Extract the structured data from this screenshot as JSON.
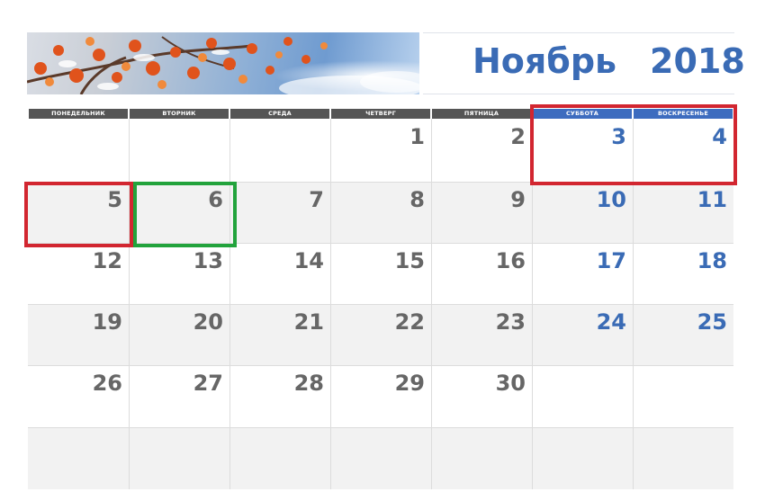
{
  "calendar": {
    "month": "Ноябрь",
    "year": "2018",
    "weekdays": [
      "ПОНЕДЕЛЬНИК",
      "ВТОРНИК",
      "СРЕДА",
      "ЧЕТВЕРГ",
      "ПЯТНИЦА",
      "СУББОТА",
      "ВОСКРЕСЕНЬЕ"
    ],
    "weeks": [
      [
        "",
        "",
        "",
        "1",
        "2",
        "3",
        "4"
      ],
      [
        "5",
        "6",
        "7",
        "8",
        "9",
        "10",
        "11"
      ],
      [
        "12",
        "13",
        "14",
        "15",
        "16",
        "17",
        "18"
      ],
      [
        "19",
        "20",
        "21",
        "22",
        "23",
        "24",
        "25"
      ],
      [
        "26",
        "27",
        "28",
        "29",
        "30",
        "",
        ""
      ],
      [
        "",
        "",
        "",
        "",
        "",
        "",
        ""
      ]
    ],
    "highlight_colors": {
      "red": "#d22630",
      "green": "#22a33c",
      "weekend": "#3a6bb5"
    }
  }
}
